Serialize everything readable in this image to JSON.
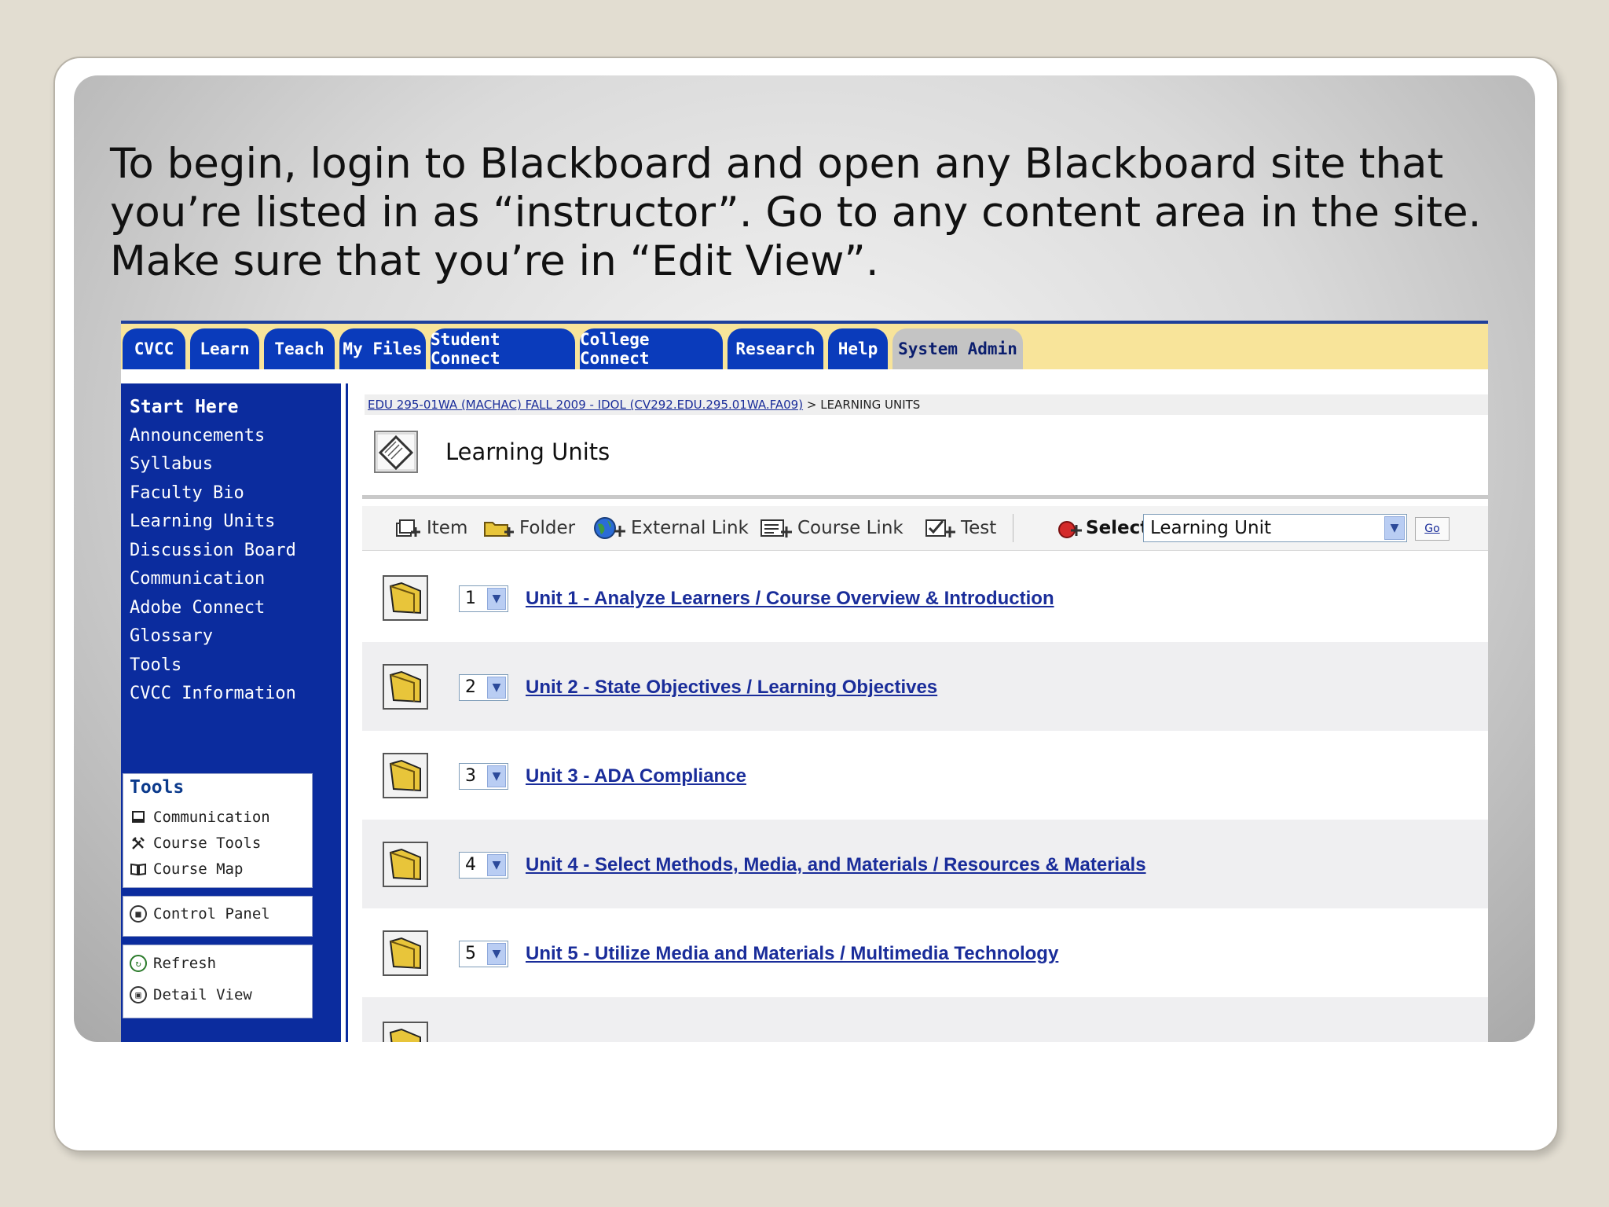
{
  "slide": {
    "instruction_lines": [
      "To begin, login to Blackboard and open any Blackboard site that",
      "you’re listed in as “instructor”.  Go to any content area in the site.",
      "Make sure that you’re in “Edit View”."
    ]
  },
  "tabs": [
    {
      "label": "CVCC"
    },
    {
      "label": "Learn"
    },
    {
      "label": "Teach"
    },
    {
      "label": "My Files"
    },
    {
      "label": "Student Connect"
    },
    {
      "label": "College Connect"
    },
    {
      "label": "Research"
    },
    {
      "label": "Help"
    },
    {
      "label": "System Admin"
    }
  ],
  "course_menu": {
    "items": [
      "Start Here",
      "Announcements",
      "Syllabus",
      "Faculty Bio",
      "Learning Units",
      "Discussion Board",
      "Communication",
      "Adobe Connect",
      "Glossary",
      "Tools",
      "CVCC Information"
    ]
  },
  "tools_panel": {
    "title": "Tools",
    "items": [
      "Communication",
      "Course Tools",
      "Course Map"
    ]
  },
  "control_panel": {
    "label": "Control Panel"
  },
  "view_panel": {
    "refresh": "Refresh",
    "detail_view": "Detail View"
  },
  "breadcrumb": {
    "course": "EDU 295-01WA (MACHAC) FALL 2009 - IDOL (CV292.EDU.295.01WA.FA09)",
    "separator": ">",
    "current": "LEARNING UNITS"
  },
  "page": {
    "title": "Learning Units"
  },
  "toolbar": {
    "item": "Item",
    "folder": "Folder",
    "external_link": "External Link",
    "course_link": "Course Link",
    "test": "Test",
    "select_label": "Select:",
    "select_value": "Learning Unit",
    "go": "Go"
  },
  "units": [
    {
      "order": "1",
      "title": "Unit 1 - Analyze Learners / Course Overview & Introduction"
    },
    {
      "order": "2",
      "title": "Unit 2 - State Objectives / Learning Objectives"
    },
    {
      "order": "3",
      "title": "Unit 3 - ADA Compliance"
    },
    {
      "order": "4",
      "title": "Unit 4 - Select Methods, Media, and Materials / Resources & Materials"
    },
    {
      "order": "5",
      "title": "Unit 5 - Utilize Media and Materials / Multimedia Technology"
    }
  ],
  "colors": {
    "tab_blue": "#0a3bbb",
    "tab_bar_yellow": "#f8e49a",
    "sidebar_blue": "#0b2c9e",
    "link_blue": "#1a2d9a",
    "folder_yellow": "#e8c53a"
  },
  "icons": {
    "title": "content-page-icon",
    "folder": "folder-icon",
    "dropdown": "chevron-down-icon"
  }
}
